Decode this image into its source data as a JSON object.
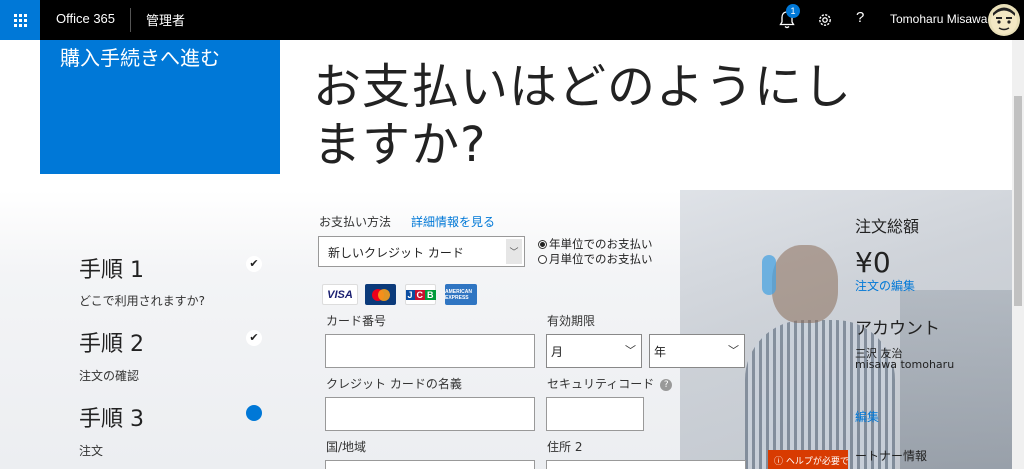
{
  "topbar": {
    "brand": "Office 365",
    "section": "管理者",
    "notification_count": "1",
    "help_label": "?",
    "user_name": "Tomoharu Misawa"
  },
  "sidebar": {
    "checkout_title": "購入手続きへ進む",
    "steps": [
      {
        "title": "手順 1",
        "description": "どこで利用されますか?",
        "status": "done"
      },
      {
        "title": "手順 2",
        "description": "注文の確認",
        "status": "done"
      },
      {
        "title": "手順 3",
        "description": "注文",
        "status": "current"
      }
    ]
  },
  "main": {
    "headline_line1": "お支払いはどのようにし",
    "headline_line2": "ますか?",
    "payment_method_label": "お支払い方法",
    "details_link": "詳細情報を見る",
    "payment_method_value": "新しいクレジット カード",
    "billing_options": [
      {
        "label": "年単位でのお支払い",
        "selected": true
      },
      {
        "label": "月単位でのお支払い",
        "selected": false
      }
    ],
    "card_brands": [
      "VISA",
      "MasterCard",
      "JCB",
      "AMERICAN EXPRESS"
    ],
    "fields": {
      "card_number_label": "カード番号",
      "expiry_label": "有効期限",
      "month_value": "月",
      "year_value": "年",
      "card_name_label": "クレジット カードの名義",
      "security_code_label": "セキュリティコード",
      "country_label": "国/地域",
      "address2_label": "住所 2"
    }
  },
  "summary": {
    "order_total_label": "注文総額",
    "order_total_value": "¥0",
    "order_edit_link": "注文の編集",
    "account_label": "アカウント",
    "account_name": "三沢 友治",
    "account_id": "misawa tomoharu",
    "account_edit_link": "編集",
    "partner_label": "ートナー情報"
  },
  "help_button": "ヘルプが必要ですか?",
  "colors": {
    "accent": "#0078d7",
    "topbar": "#000000",
    "help": "#d83b01"
  }
}
